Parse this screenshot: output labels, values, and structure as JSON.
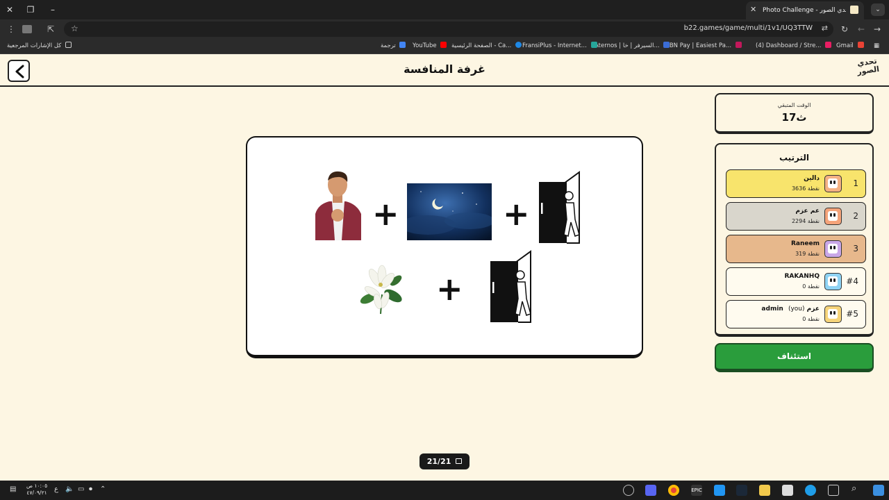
{
  "browser": {
    "tab_title": "Photo Challenge - تحدي الصور",
    "url": "b22.games/game/multi/1v1/UQ3TTW",
    "bookmarks": [
      "Gmail",
      "(4) Dashboard / Stre...",
      "ABN Pay | Easiest Pa...",
      "Aternos | السيرفر | خا...",
      "FransiPlus - Internet...",
      "الصفحة الرئيسية - Ca...",
      "YouTube",
      "ترجمة"
    ],
    "all_bookmarks": "كل الإشارات المرجعية"
  },
  "header": {
    "title": "غرفة المنافسة",
    "logo_text": "تحدي الصور"
  },
  "timer": {
    "label": "الوقت المتبقي",
    "value": "17ث"
  },
  "ranking": {
    "title": "الترتيب",
    "players": [
      {
        "rank": "1",
        "name": "دالين",
        "you": "",
        "score": "3636 نقطة",
        "bg": "#f8e46c",
        "avatar_bg": "#f4b183"
      },
      {
        "rank": "2",
        "name": "عم عزم",
        "you": "",
        "score": "2294 نقطة",
        "bg": "#d9d6cc",
        "avatar_bg": "#f4a37a"
      },
      {
        "rank": "3",
        "name": "Raneem",
        "you": "",
        "score": "319 نقطة",
        "bg": "#e7b88c",
        "avatar_bg": "#c9a7e8"
      },
      {
        "rank": "#4",
        "name": "RAKANHQ",
        "you": "",
        "score": "0 نقطة",
        "bg": "#fffbef",
        "avatar_bg": "#8fd3f4"
      },
      {
        "rank": "#5",
        "name": "عزم",
        "you": "(you)",
        "score": "0 نقطة",
        "prefix": "admin",
        "bg": "#fffbef",
        "avatar_bg": "#f6d47a"
      }
    ]
  },
  "resume_button": "استئناف",
  "counter": "21/21",
  "puzzle_icons": [
    "man-pointing-image",
    "night-moon-sky-image",
    "exit-door-icon",
    "lily-flower-image",
    "exit-door-icon"
  ],
  "taskbar": {
    "time": "١٠:٠٥ ص",
    "date": "٤٧/٠٩/٢١",
    "lang": "ع"
  }
}
